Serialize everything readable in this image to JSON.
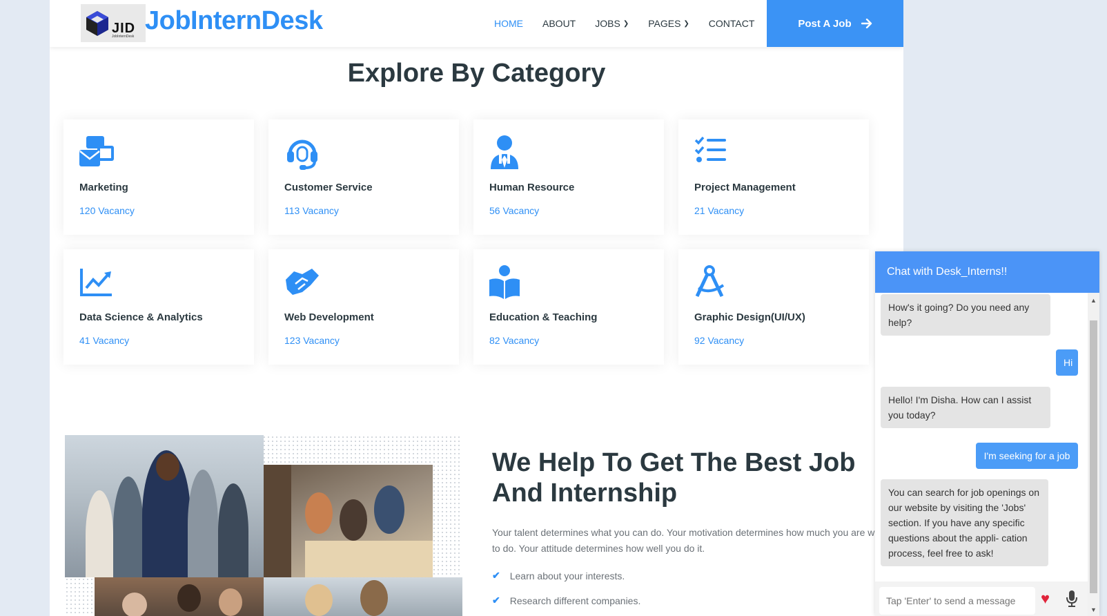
{
  "header": {
    "logo_letters": "JID",
    "logo_sub": "JobInternDesk",
    "brand": "JobInternDesk",
    "nav": [
      {
        "label": "HOME"
      },
      {
        "label": "ABOUT"
      },
      {
        "label": "JOBS"
      },
      {
        "label": "PAGES"
      },
      {
        "label": "CONTACT"
      }
    ],
    "post_job_label": "Post A Job",
    "accent": "#2e8ff5"
  },
  "categories": {
    "title": "Explore By Category",
    "items": [
      {
        "name": "Marketing",
        "vacancy": "120 Vacancy",
        "icon": "mail-icon"
      },
      {
        "name": "Customer Service",
        "vacancy": "113 Vacancy",
        "icon": "headset-icon"
      },
      {
        "name": "Human Resource",
        "vacancy": "56 Vacancy",
        "icon": "user-tie-icon"
      },
      {
        "name": "Project Management",
        "vacancy": "21 Vacancy",
        "icon": "task-list-icon"
      },
      {
        "name": "Data Science & Analytics",
        "vacancy": "41 Vacancy",
        "icon": "chart-line-icon"
      },
      {
        "name": "Web Development",
        "vacancy": "123 Vacancy",
        "icon": "handshake-icon"
      },
      {
        "name": "Education & Teaching",
        "vacancy": "82 Vacancy",
        "icon": "book-reader-icon"
      },
      {
        "name": "Graphic Design(UI/UX)",
        "vacancy": "92 Vacancy",
        "icon": "compass-drafting-icon"
      }
    ]
  },
  "about": {
    "title": "We Help To Get The Best Job And Internship",
    "text": "Your talent determines what you can do. Your motivation determines how much you are willing to do. Your attitude determines how well you do it.",
    "bullets": [
      "Learn about your interests.",
      "Research different companies."
    ]
  },
  "chat": {
    "title": "Chat with Desk_Interns!!",
    "messages": [
      {
        "from": "bot",
        "text": "How's it going? Do you need any help?"
      },
      {
        "from": "user",
        "text": "Hi"
      },
      {
        "from": "bot",
        "text": "Hello! I'm Disha. How can I assist you today?"
      },
      {
        "from": "user",
        "text": "I'm seeking for a job"
      },
      {
        "from": "bot",
        "text": "You can search for job openings on our website by visiting the 'Jobs' section. If you have any specific questions about the appli- cation process, feel free to ask!"
      }
    ],
    "input_placeholder": "Tap 'Enter' to send a message",
    "header_color": "#4b94f7"
  }
}
